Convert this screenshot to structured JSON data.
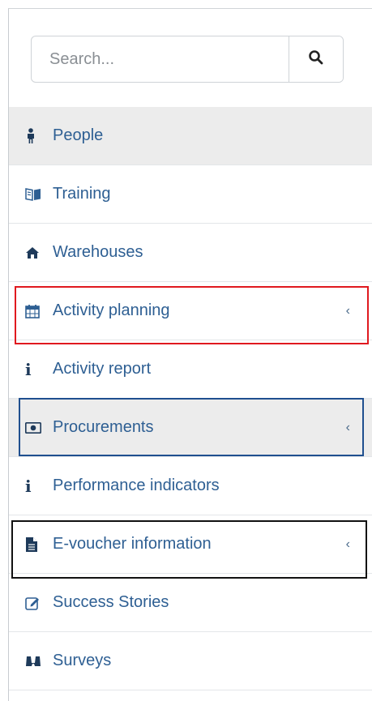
{
  "search": {
    "placeholder": "Search...",
    "icon": "search-icon"
  },
  "menu": {
    "items": [
      {
        "label": "People",
        "icon": "person-icon",
        "active": true
      },
      {
        "label": "Training",
        "icon": "book-icon"
      },
      {
        "label": "Warehouses",
        "icon": "home-icon"
      },
      {
        "label": "Activity planning",
        "icon": "calendar-icon",
        "has_submenu": true
      },
      {
        "label": "Activity report",
        "icon": "info-icon"
      },
      {
        "label": "Procurements",
        "icon": "money-icon",
        "has_submenu": true
      },
      {
        "label": "Performance indicators",
        "icon": "info-icon"
      },
      {
        "label": "E-voucher information",
        "icon": "file-icon",
        "has_submenu": true
      },
      {
        "label": "Success Stories",
        "icon": "edit-icon"
      },
      {
        "label": "Surveys",
        "icon": "binoculars-icon"
      }
    ],
    "chevron": "‹"
  },
  "colors": {
    "text": "#2e5f93",
    "active_bg": "#ececec",
    "highlight_red": "#e0191f",
    "highlight_blue": "#1f4f8f",
    "highlight_black": "#111111"
  }
}
